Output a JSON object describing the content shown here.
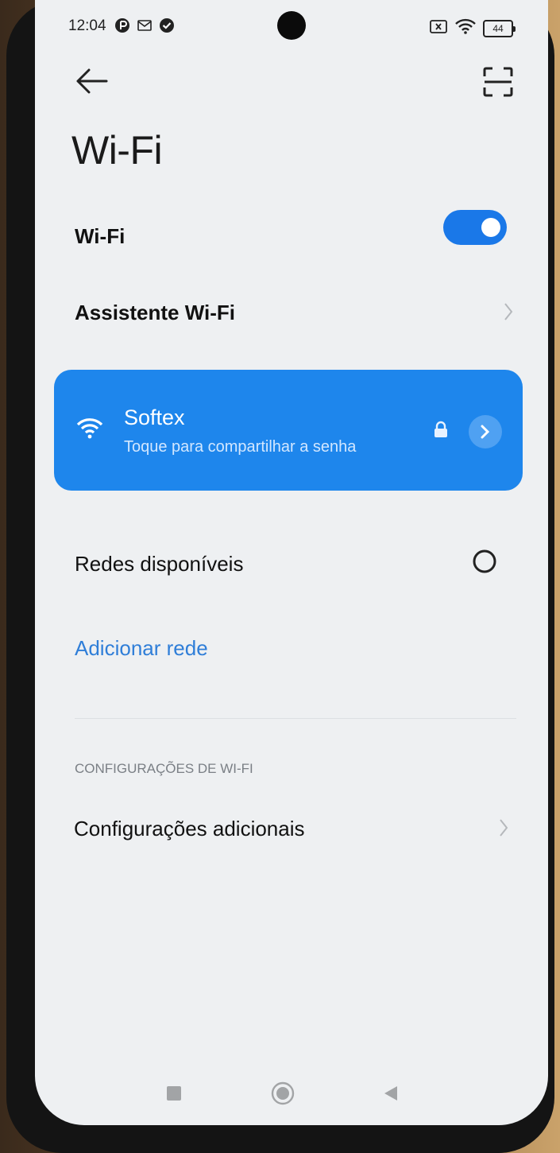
{
  "status_bar": {
    "time": "12:04",
    "battery_level": "44",
    "icons": [
      "reminder-icon",
      "gmail-icon",
      "check-circle-icon",
      "no-sim-icon",
      "wifi-signal-icon",
      "battery-icon"
    ]
  },
  "header": {
    "back_icon": "arrow-left-icon",
    "scan_icon": "qr-scan-icon",
    "title": "Wi-Fi"
  },
  "wifi_toggle": {
    "label": "Wi-Fi",
    "on": true
  },
  "assistant": {
    "label": "Assistente Wi-Fi"
  },
  "connected_network": {
    "name": "Softex",
    "subtitle": "Toque para compartilhar a senha",
    "secured": true,
    "color": "#1e86ec"
  },
  "available_networks": {
    "label": "Redes disponíveis",
    "add_network_label": "Adicionar rede"
  },
  "settings_section": {
    "header": "CONFIGURAÇÕES DE WI-FI",
    "additional_label": "Configurações adicionais"
  },
  "colors": {
    "accent": "#1a78e8",
    "link": "#2f7ed8",
    "background": "#eef0f2"
  }
}
